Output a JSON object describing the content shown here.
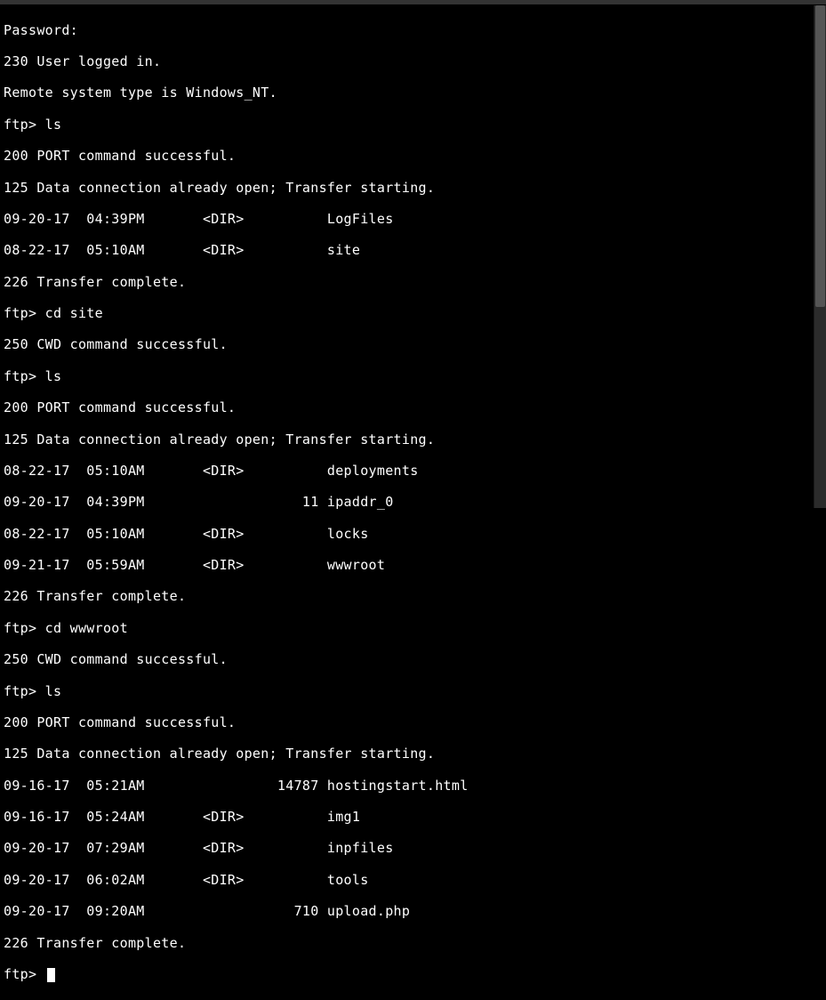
{
  "session": {
    "password_prompt": "Password:",
    "login_msg": "230 User logged in.",
    "system_type": "Remote system type is Windows_NT."
  },
  "block1": {
    "prompt": "ftp> ",
    "cmd": "ls",
    "port_msg": "200 PORT command successful.",
    "data_msg": "125 Data connection already open; Transfer starting.",
    "rows": [
      "09-20-17  04:39PM       <DIR>          LogFiles",
      "08-22-17  05:10AM       <DIR>          site"
    ],
    "complete": "226 Transfer complete."
  },
  "block2": {
    "prompt": "ftp> ",
    "cmd": "cd site",
    "cwd_msg": "250 CWD command successful."
  },
  "block3": {
    "prompt": "ftp> ",
    "cmd": "ls",
    "port_msg": "200 PORT command successful.",
    "data_msg": "125 Data connection already open; Transfer starting.",
    "rows": [
      "08-22-17  05:10AM       <DIR>          deployments",
      "09-20-17  04:39PM                   11 ipaddr_0",
      "08-22-17  05:10AM       <DIR>          locks",
      "09-21-17  05:59AM       <DIR>          wwwroot"
    ],
    "complete": "226 Transfer complete."
  },
  "block4": {
    "prompt": "ftp> ",
    "cmd": "cd wwwroot",
    "cwd_msg": "250 CWD command successful."
  },
  "block5": {
    "prompt": "ftp> ",
    "cmd": "ls",
    "port_msg": "200 PORT command successful.",
    "data_msg": "125 Data connection already open; Transfer starting.",
    "rows": [
      "09-16-17  05:21AM                14787 hostingstart.html",
      "09-16-17  05:24AM       <DIR>          img1",
      "09-20-17  07:29AM       <DIR>          inpfiles",
      "09-20-17  06:02AM       <DIR>          tools",
      "09-20-17  09:20AM                  710 upload.php"
    ],
    "complete": "226 Transfer complete."
  },
  "final_prompt": "ftp> "
}
